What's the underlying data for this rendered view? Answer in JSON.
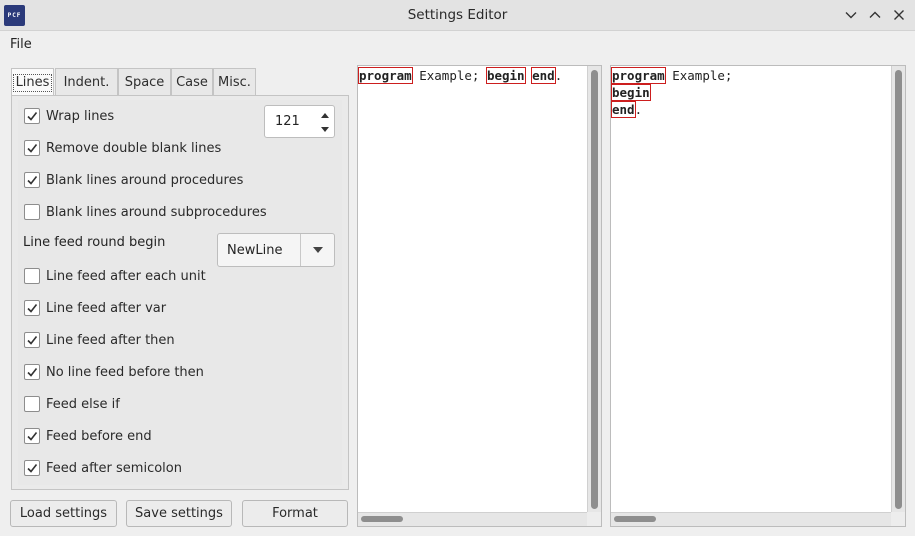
{
  "window": {
    "title": "Settings Editor",
    "icon_text": "PCF",
    "controls": [
      "chevron-down-icon",
      "chevron-up-icon",
      "close-icon"
    ]
  },
  "menu": {
    "file": "File"
  },
  "tabs": [
    {
      "label": "Lines",
      "active": true
    },
    {
      "label": "Indent.",
      "active": false
    },
    {
      "label": "Space",
      "active": false
    },
    {
      "label": "Case",
      "active": false
    },
    {
      "label": "Misc.",
      "active": false
    }
  ],
  "options": [
    {
      "label": "Wrap lines",
      "checked": true
    },
    {
      "label": "Remove double blank lines",
      "checked": true
    },
    {
      "label": "Blank lines around procedures",
      "checked": true
    },
    {
      "label": "Blank lines around subprocedures",
      "checked": false
    },
    {
      "label": "Line feed after each unit",
      "checked": false
    },
    {
      "label": "Line feed after var",
      "checked": true
    },
    {
      "label": "Line feed after then",
      "checked": true
    },
    {
      "label": "No line feed before then",
      "checked": true
    },
    {
      "label": "Feed else if",
      "checked": false
    },
    {
      "label": "Feed before end",
      "checked": true
    },
    {
      "label": "Feed after semicolon",
      "checked": true
    }
  ],
  "wrap_width": "121",
  "line_feed_begin": {
    "label": "Line feed round begin",
    "value": "NewLine"
  },
  "buttons": {
    "load": "Load settings",
    "save": "Save settings",
    "format": "Format"
  },
  "source_code": {
    "line1": {
      "kw1": "program",
      "text1": " Example; ",
      "kw2": "begin",
      "text2": " ",
      "kw3": "end",
      "text3": "."
    }
  },
  "formatted_code": {
    "line1": {
      "kw": "program",
      "text": " Example;"
    },
    "line2": {
      "kw": "begin"
    },
    "line3": {
      "kw": "end",
      "text": "."
    }
  },
  "colors": {
    "keyword_outline": "#cc1e1e",
    "app_icon": "#2b3a7a"
  }
}
